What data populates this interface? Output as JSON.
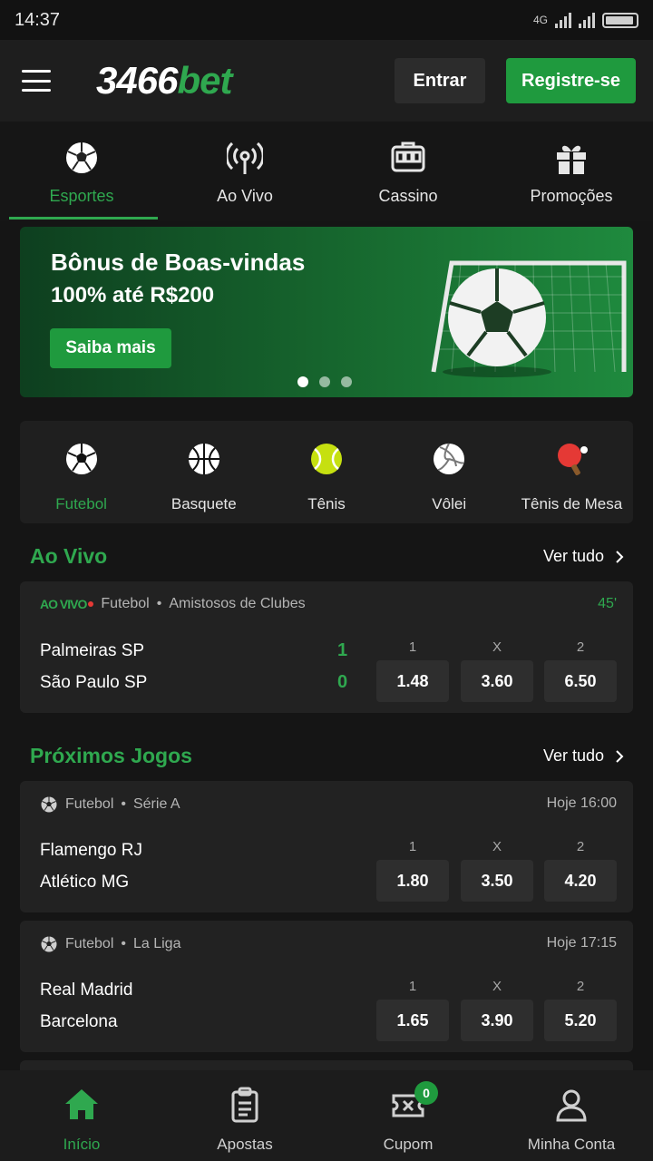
{
  "status_bar": {
    "time": "14:37",
    "network": "4G",
    "battery_icon": "battery-icon"
  },
  "header": {
    "logo_number": "3466",
    "logo_suffix": "bet",
    "login_label": "Entrar",
    "register_label": "Registre-se"
  },
  "main_tabs": [
    {
      "label": "Esportes",
      "icon": "soccer-ball-icon",
      "active": true
    },
    {
      "label": "Ao Vivo",
      "icon": "broadcast-icon",
      "active": false
    },
    {
      "label": "Cassino",
      "icon": "slot-machine-icon",
      "active": false
    },
    {
      "label": "Promoções",
      "icon": "gift-icon",
      "active": false
    }
  ],
  "banner": {
    "title": "Bônus de Boas-vindas",
    "subtitle": "100% até R$200",
    "cta": "Saiba mais",
    "active_slide": 1,
    "slide_count": 3
  },
  "sports": [
    {
      "label": "Futebol",
      "icon": "soccer-ball-icon",
      "active": true
    },
    {
      "label": "Basquete",
      "icon": "basketball-icon",
      "active": false
    },
    {
      "label": "Tênis",
      "icon": "tennis-ball-icon",
      "active": false
    },
    {
      "label": "Vôlei",
      "icon": "volleyball-icon",
      "active": false
    },
    {
      "label": "Tênis de Mesa",
      "icon": "table-tennis-icon",
      "active": false
    }
  ],
  "live_section": {
    "title": "Ao Vivo",
    "see_all": "Ver tudo",
    "match": {
      "live_tag": "AO VIVO",
      "sport": "Futebol",
      "league": "Amistosos de Clubes",
      "minute": "45'",
      "home": "Palmeiras SP",
      "away": "São Paulo SP",
      "home_score": "1",
      "away_score": "0",
      "odds_headers": [
        "1",
        "X",
        "2"
      ],
      "odds": [
        "1.48",
        "3.60",
        "6.50"
      ]
    }
  },
  "upcoming_section": {
    "title": "Próximos Jogos",
    "see_all": "Ver tudo",
    "matches": [
      {
        "sport": "Futebol",
        "league": "Série A",
        "time": "Hoje 16:00",
        "home": "Flamengo RJ",
        "away": "Atlético MG",
        "odds_headers": [
          "1",
          "X",
          "2"
        ],
        "odds": [
          "1.80",
          "3.50",
          "4.20"
        ]
      },
      {
        "sport": "Futebol",
        "league": "La Liga",
        "time": "Hoje 17:15",
        "home": "Real Madrid",
        "away": "Barcelona",
        "odds_headers": [
          "1",
          "X",
          "2"
        ],
        "odds": [
          "1.65",
          "3.90",
          "5.20"
        ]
      }
    ]
  },
  "bottom_nav": [
    {
      "label": "Início",
      "icon": "home-icon",
      "active": true
    },
    {
      "label": "Apostas",
      "icon": "clipboard-icon",
      "active": false
    },
    {
      "label": "Cupom",
      "icon": "ticket-icon",
      "active": false,
      "badge": "0"
    },
    {
      "label": "Minha Conta",
      "icon": "user-icon",
      "active": false
    }
  ],
  "colors": {
    "accent": "#2fa84f",
    "background": "#151515",
    "card": "#222222",
    "live_red": "#e53935"
  }
}
